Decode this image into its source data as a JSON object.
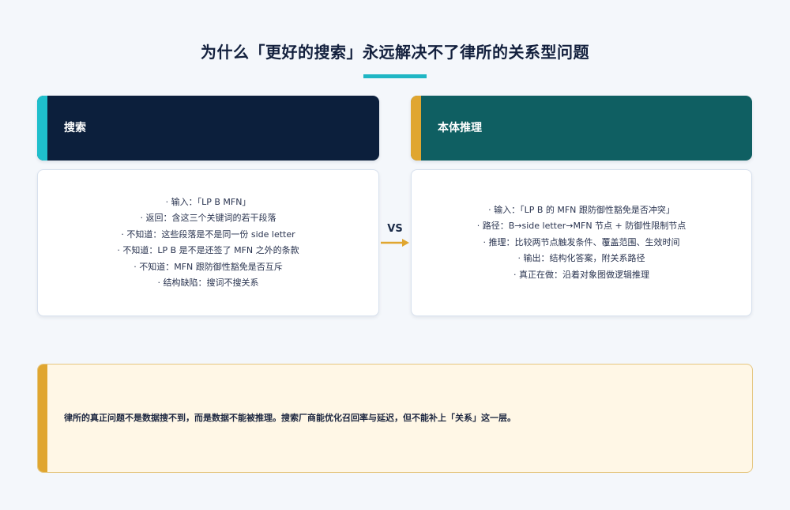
{
  "title": "为什么「更好的搜索」永远解决不了律所的关系型问题",
  "colors": {
    "title_underline": "#1fb6c4",
    "left_header_bg": "#0c1f3c",
    "left_accent": "#1fbfcc",
    "right_header_bg": "#0f5f62",
    "right_accent": "#e0a630",
    "conclusion_bg": "#fff7e6",
    "conclusion_accent": "#e0a630"
  },
  "left": {
    "header": "搜索",
    "lines": [
      "· 输入：「LP B MFN」",
      "· 返回：含这三个关键词的若干段落",
      "· 不知道：这些段落是不是同一份 side letter",
      "· 不知道：LP B 是不是还签了 MFN 之外的条款",
      "· 不知道：MFN 跟防御性豁免是否互斥",
      "· 结构缺陷：搜词不搜关系"
    ]
  },
  "vs_label": "VS",
  "right": {
    "header": "本体推理",
    "lines": [
      "· 输入：「LP B 的 MFN 跟防御性豁免是否冲突」",
      "· 路径：B→side letter→MFN 节点 + 防御性限制节点",
      "· 推理：比较两节点触发条件、覆盖范围、生效时间",
      "· 输出：结构化答案，附关系路径",
      "· 真正在做：沿着对象图做逻辑推理"
    ]
  },
  "conclusion": "律所的真正问题不是数据搜不到，而是数据不能被推理。搜索厂商能优化召回率与延迟，但不能补上「关系」这一层。"
}
